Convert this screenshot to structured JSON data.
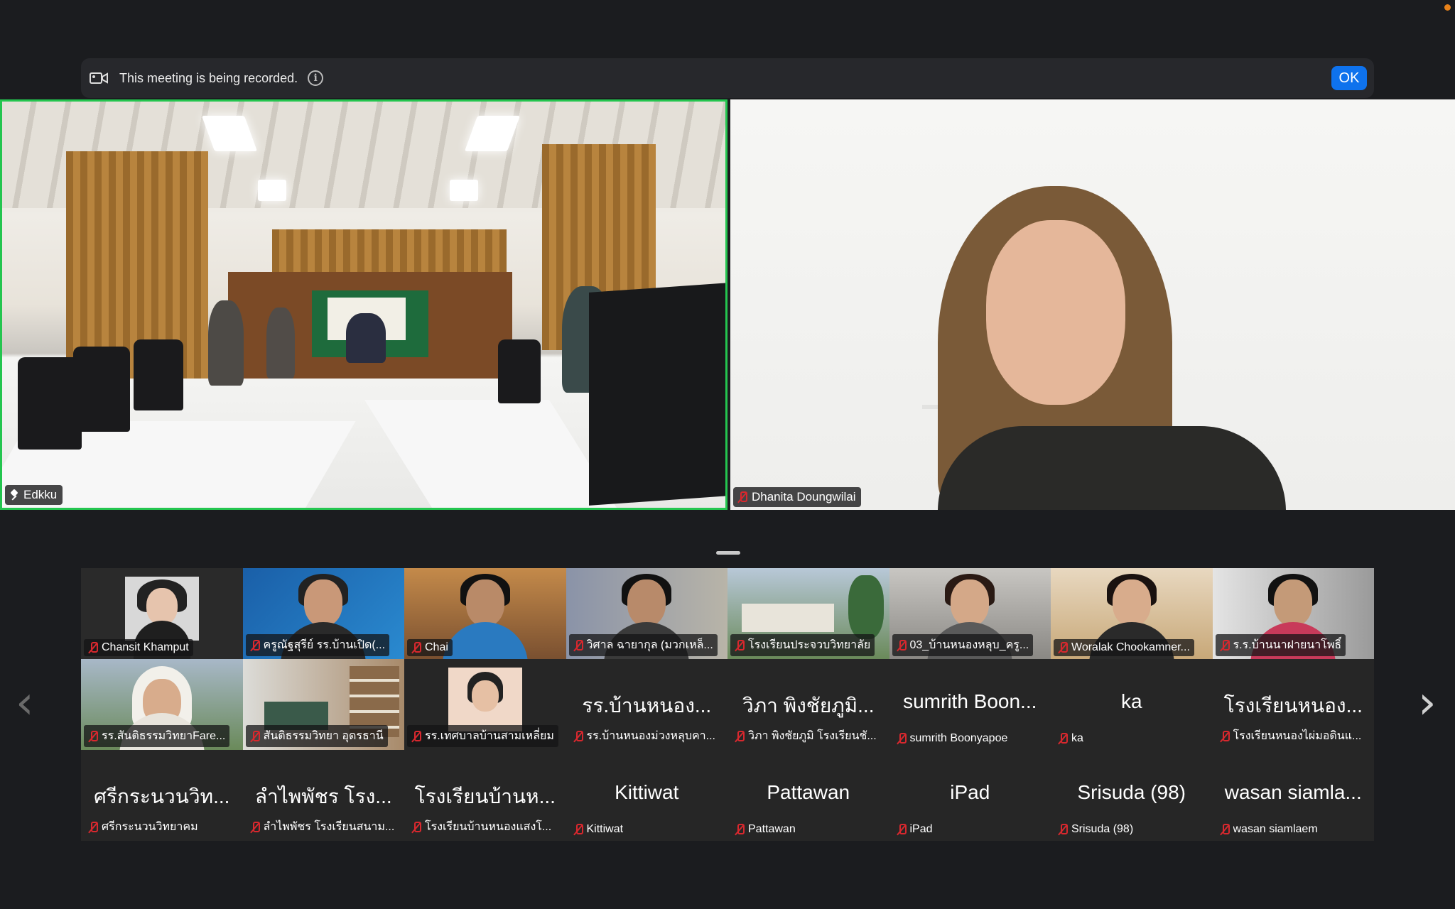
{
  "banner": {
    "message": "This meeting is being recorded.",
    "ok_label": "OK"
  },
  "main_videos": [
    {
      "name": "Edkku",
      "pinned": true,
      "active_speaker": true
    },
    {
      "name": "Dhanita Doungwilai",
      "muted": true
    }
  ],
  "gallery": [
    {
      "name": "Chansit Khamput",
      "muted": true,
      "video": true
    },
    {
      "name": "ครูณัฐสุรีย์ รร.บ้านเปิด(...",
      "muted": true,
      "video": true
    },
    {
      "name": "Chai",
      "muted": true,
      "video": true
    },
    {
      "name": "วิศาล ฉายากุล (มวกเหล็...",
      "muted": true,
      "video": true
    },
    {
      "name": "โรงเรียนประจวบวิทยาลัย",
      "muted": true,
      "video": true
    },
    {
      "name": "03_บ้านหนองหลุบ_ครู...",
      "muted": true,
      "video": true
    },
    {
      "name": "Woralak Chookamner...",
      "muted": true,
      "video": true
    },
    {
      "name": "ร.ร.บ้านนาฝายนาโพธิ์",
      "muted": true,
      "video": true
    },
    {
      "name": "รร.สันติธรรมวิทยาFare...",
      "muted": true,
      "video": true
    },
    {
      "name": "สันติธรรมวิทยา อุดรธานี",
      "muted": true,
      "video": true
    },
    {
      "name": "รร.เทศบาลบ้านสามเหลี่ยม",
      "muted": true,
      "video": true
    },
    {
      "display": "รร.บ้านหนอง...",
      "name": "รร.บ้านหนองม่วงหลุบคา...",
      "muted": true,
      "video": false
    },
    {
      "display": "วิภา พิงชัยภูมิ...",
      "name": "วิภา พิงชัยภูมิ โรงเรียนชั...",
      "muted": true,
      "video": false
    },
    {
      "display": "sumrith Boon...",
      "name": "sumrith Boonyapoe",
      "muted": true,
      "video": false
    },
    {
      "display": "ka",
      "name": "ka",
      "muted": true,
      "video": false
    },
    {
      "display": "โรงเรียนหนอง...",
      "name": "โรงเรียนหนองไผ่มอดินแ...",
      "muted": true,
      "video": false
    },
    {
      "display": "ศรีกระนวนวิท...",
      "name": "ศรีกระนวนวิทยาคม",
      "muted": true,
      "video": false
    },
    {
      "display": "ลำไพพัชร โรง...",
      "name": "ลำไพพัชร โรงเรียนสนาม...",
      "muted": true,
      "video": false
    },
    {
      "display": "โรงเรียนบ้านห...",
      "name": "โรงเรียนบ้านหนองแสงโ...",
      "muted": true,
      "video": false
    },
    {
      "display": "Kittiwat",
      "name": "Kittiwat",
      "muted": true,
      "video": false
    },
    {
      "display": "Pattawan",
      "name": "Pattawan",
      "muted": true,
      "video": false
    },
    {
      "display": "iPad",
      "name": "iPad",
      "muted": true,
      "video": false
    },
    {
      "display": "Srisuda (98)",
      "name": "Srisuda (98)",
      "muted": true,
      "video": false
    },
    {
      "display": "wasan siamla...",
      "name": "wasan siamlaem",
      "muted": true,
      "video": false
    }
  ],
  "nav": {
    "prev_icon": "‹",
    "next_icon": "›"
  },
  "colors": {
    "active_speaker_border": "#24c54f",
    "muted_mic": "#d8282e",
    "ok_button": "#0e72ed"
  }
}
